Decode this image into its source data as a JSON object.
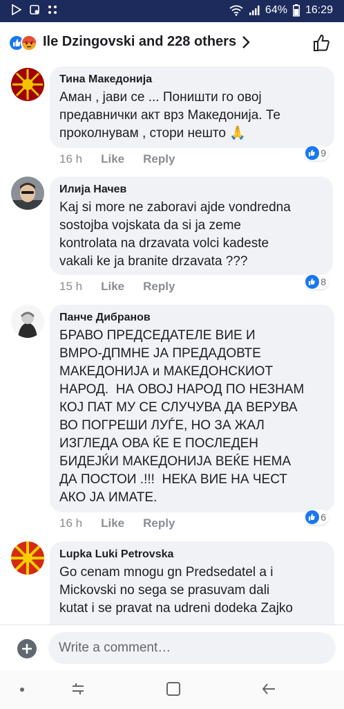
{
  "status": {
    "battery": "64%",
    "time": "16:29",
    "icons": [
      "play-store-icon",
      "notification-icon",
      "dots-icon",
      "wifi-icon",
      "signal-icon",
      "battery-icon"
    ]
  },
  "header": {
    "title": "Ile Dzingovski and 228 others",
    "reactions": [
      "like-reaction-icon",
      "angry-reaction-icon"
    ]
  },
  "comments": [
    {
      "author": "Тина Македонија",
      "text": "Аман , јави се ... Поништи го овој\nпредавнички акт врз Македонија. Те\nпроколнувам , стори нешто",
      "emoji": "🙏",
      "time": "16 h",
      "like": "Like",
      "reply": "Reply",
      "likes": "9"
    },
    {
      "author": "Илија Начев",
      "text": "Kaj si more ne zaboravi ajde vondredna\nsostojba vojskata da si ja zeme\nkontrolata na drzavata volci kadeste\nvakali ke ja branite drzavata ???",
      "time": "15 h",
      "like": "Like",
      "reply": "Reply",
      "likes": "8"
    },
    {
      "author": "Панче Дибранов",
      "text": "БРАВО ПРЕДСЕДАТЕЛЕ ВИЕ И\nВМРО-ДПМНЕ ЈА ПРЕДАДОВТЕ\nМАКЕДОНИЈА и МАКЕДОНСКИОТ\nНАРОД.  НА ОВОЈ НАРОД ПО НЕЗНАМ\nКОЈ ПАТ МУ СЕ СЛУЧУВА ДА ВЕРУВА\nВО ПОГРЕШИ ЛУЃЕ, НО ЗА ЖАЛ\nИЗГЛЕДА ОВА ЌЕ Е ПОСЛЕДЕН\nБИДЕЈЌИ МАКЕДОНИЈА ВЕЌЕ НЕМА\nДА ПОСТОИ .!!!  НЕКА ВИЕ НА ЧЕСТ\nАКО ЈА ИМАТЕ.",
      "time": "16 h",
      "like": "Like",
      "reply": "Reply",
      "likes": "6"
    },
    {
      "author": "Lupka Luki Petrovska",
      "text": "Go cenam mnogu gn Predsedatel a i\nMickovski no sega se prasuvam dali\nkutat i se pravat na udreni dodeka Zajko"
    }
  ],
  "composer": {
    "placeholder": "Write a comment…"
  },
  "navbar": {
    "icons": [
      "home-dot-icon",
      "recent-apps-icon",
      "home-button-icon",
      "back-icon"
    ]
  },
  "colors": {
    "statusbar": "#1c2b5c",
    "like_blue": "#1877f2",
    "bubble": "#f0f2f5"
  }
}
